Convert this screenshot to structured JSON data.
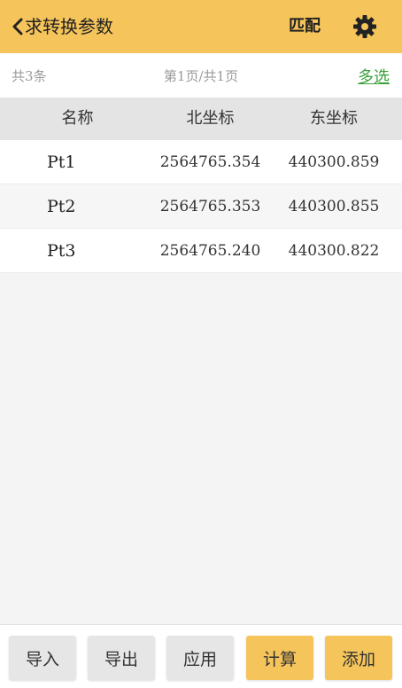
{
  "header": {
    "title": "求转换参数",
    "match_label": "匹配",
    "back_icon": "chevron-left-icon",
    "settings_icon": "gear-icon"
  },
  "info": {
    "count": "共3条",
    "page": "第1页/共1页",
    "multi_select": "多选"
  },
  "table": {
    "headers": [
      "名称",
      "北坐标",
      "东坐标"
    ],
    "rows": [
      {
        "name": "Pt1",
        "north": "2564765.354",
        "east": "440300.859"
      },
      {
        "name": "Pt2",
        "north": "2564765.353",
        "east": "440300.855"
      },
      {
        "name": "Pt3",
        "north": "2564765.240",
        "east": "440300.822"
      }
    ]
  },
  "bottom": {
    "import": "导入",
    "export": "导出",
    "apply": "应用",
    "calculate": "计算",
    "add": "添加"
  },
  "colors": {
    "accent": "#f5c45a",
    "link": "#3aa03a"
  }
}
